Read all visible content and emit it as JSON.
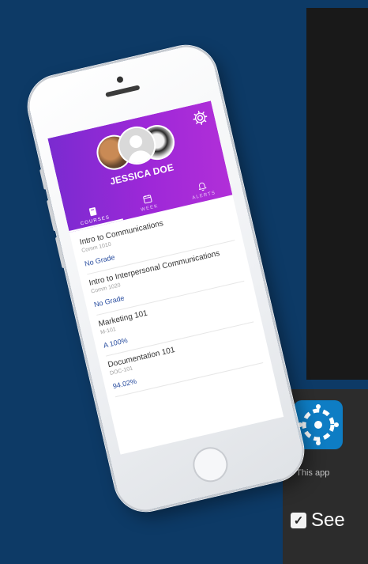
{
  "phone": {
    "user_name": "JESSICA DOE",
    "tabs": [
      {
        "label": "COURSES",
        "icon": "book-icon",
        "active": true
      },
      {
        "label": "WEEK",
        "icon": "calendar-icon",
        "active": false
      },
      {
        "label": "ALERTS",
        "icon": "bell-icon",
        "active": false
      }
    ],
    "courses": [
      {
        "title": "Intro to Communications",
        "code": "Comm 1010",
        "grade": "No Grade"
      },
      {
        "title": "Intro to Interpersonal Communications",
        "code": "Comm 1020",
        "grade": "No Grade"
      },
      {
        "title": "Marketing 101",
        "code": "M-101",
        "grade": "A  100%"
      },
      {
        "title": "Documentation 101",
        "code": "DOC-101",
        "grade": "94.02%"
      }
    ]
  },
  "side_card": {
    "note": "* This app",
    "checkbox_label": "See",
    "checkbox_checked": true,
    "app_icon": "canvas-app-icon"
  },
  "colors": {
    "background": "#0d3a66",
    "header_gradient_start": "#7a2bd0",
    "header_gradient_end": "#b12fd8",
    "grade_text": "#2a4ea0"
  }
}
